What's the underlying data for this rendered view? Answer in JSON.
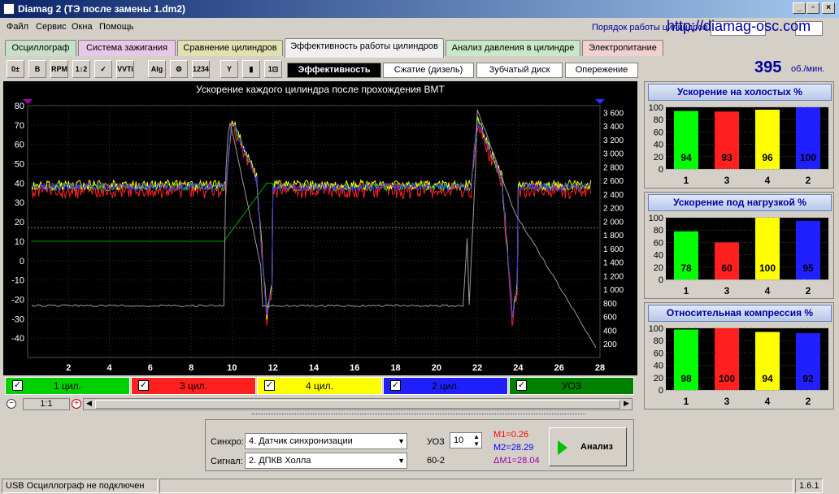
{
  "window": {
    "title": "Diamag 2 (ТЭ после замены 1.dm2)"
  },
  "menu": [
    "Файл",
    "Сервис",
    "Окна",
    "Помощь"
  ],
  "header": {
    "cyl_order_label": "Порядок работы цилиндров",
    "url": "http://diamag-osc.com"
  },
  "tabs": [
    {
      "label": "Осциллограф",
      "color": "#c8e0c8"
    },
    {
      "label": "Система зажигания",
      "color": "#e8c8e8"
    },
    {
      "label": "Сравнение цилиндров",
      "color": "#e0e0b0"
    },
    {
      "label": "Эффективность работы цилиндров",
      "color": "#f0f0f0"
    },
    {
      "label": "Анализ давления в цилиндре",
      "color": "#c8e8c8"
    },
    {
      "label": "Электропитание",
      "color": "#f0d0d0"
    }
  ],
  "toolbar_icons": [
    "0±",
    "B",
    "RPM",
    "1↕2",
    "✓",
    "VVTi",
    "Alg 1/2",
    "⚙",
    "1234",
    "Y",
    "▮",
    "1⊡"
  ],
  "subtabs": [
    "Эффективность",
    "Сжатие (дизель)",
    "Зубчатый диск",
    "Опережение"
  ],
  "rpm": {
    "value": "395",
    "unit": "об./мин."
  },
  "chart_data": {
    "type": "line",
    "title": "Ускорение каждого цилиндра после прохождения ВМТ",
    "xlim": [
      0,
      28
    ],
    "x_ticks": [
      2,
      4,
      6,
      8,
      10,
      12,
      14,
      16,
      18,
      20,
      22,
      24,
      26,
      28
    ],
    "ylim_left": [
      -50,
      80
    ],
    "y_ticks_left": [
      80,
      70,
      60,
      50,
      40,
      30,
      20,
      10,
      0,
      -10,
      -20,
      -30,
      -40
    ],
    "ylim_right": [
      0,
      3700
    ],
    "y_ticks_right": [
      "3 600",
      "3 400",
      "3 200",
      "3 000",
      "2 800",
      "2 600",
      "2 400",
      "2 200",
      "2 000",
      "1 800",
      "1 600",
      "1 400",
      "1 200",
      "1 000",
      "800",
      "600",
      "400",
      "200"
    ],
    "series": [
      {
        "name": "1 цил.",
        "color": "#00ff00"
      },
      {
        "name": "3 цил.",
        "color": "#ff2020"
      },
      {
        "name": "4 цил.",
        "color": "#ffff00"
      },
      {
        "name": "2 цил.",
        "color": "#3030ff"
      },
      {
        "name": "УОЗ",
        "color": "#00a000"
      }
    ]
  },
  "legend": [
    {
      "label": "1 цил.",
      "bg": "#00d000",
      "fg": "#000"
    },
    {
      "label": "3 цил.",
      "bg": "#ff2020",
      "fg": "#000"
    },
    {
      "label": "4 цил.",
      "bg": "#ffff00",
      "fg": "#000"
    },
    {
      "label": "2 цил.",
      "bg": "#2020ff",
      "fg": "#000"
    },
    {
      "label": "УОЗ",
      "bg": "#008000",
      "fg": "#000"
    }
  ],
  "zoom": {
    "value": "1:1"
  },
  "panels": [
    {
      "title": "Ускорение на холостых %",
      "cats": [
        "1",
        "3",
        "4",
        "2"
      ],
      "values": [
        94,
        93,
        96,
        100
      ]
    },
    {
      "title": "Ускорение под нагрузкой %",
      "cats": [
        "1",
        "3",
        "4",
        "2"
      ],
      "values": [
        78,
        60,
        100,
        95
      ]
    },
    {
      "title": "Относительная компрессия %",
      "cats": [
        "1",
        "3",
        "4",
        "2"
      ],
      "values": [
        98,
        100,
        94,
        92
      ]
    }
  ],
  "panel_yticks": [
    "100",
    "80",
    "60",
    "40",
    "20",
    "0"
  ],
  "bar_colors": [
    "#00ff00",
    "#ff2020",
    "#ffff00",
    "#2020ff"
  ],
  "controls": {
    "sync_label": "Синхро:",
    "sync_value": "4.  Датчик синхронизации",
    "signal_label": "Сигнал:",
    "signal_value": "2.  ДПКВ Холла",
    "uoz_label": "УОЗ",
    "uoz_value": "10",
    "teeth": "60-2",
    "m1": "M1=0.26",
    "m2": "M2=28.29",
    "dm": "ΔM1=28.04",
    "analyze": "Анализ"
  },
  "status": {
    "left": "USB Осциллограф не подключен",
    "version": "1.6.1"
  }
}
